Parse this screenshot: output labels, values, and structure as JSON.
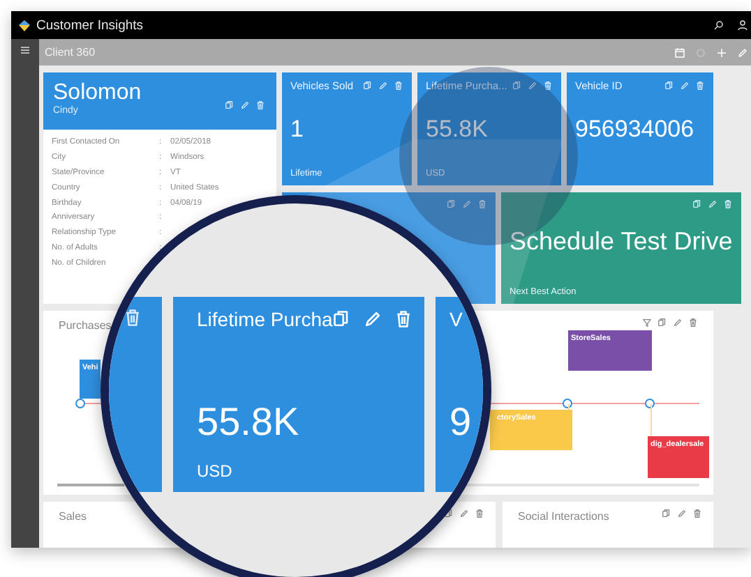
{
  "window": {
    "title": "Customer Insights"
  },
  "page": {
    "title": "Client 360"
  },
  "contact_card": {
    "name": "Solomon",
    "subtitle": "Cindy",
    "fields": [
      {
        "label": "First Contacted On",
        "separator": ":",
        "value": "02/05/2018"
      },
      {
        "label": "City",
        "separator": ":",
        "value": "Windsors"
      },
      {
        "label": "State/Province",
        "separator": ":",
        "value": "VT"
      },
      {
        "label": "Country",
        "separator": ":",
        "value": "United States"
      },
      {
        "label": "Birthday",
        "separator": ":",
        "value": "04/08/19"
      },
      {
        "label": "Anniversary",
        "separator": ":"
      },
      {
        "label": "Relationship Type",
        "separator": ":"
      },
      {
        "label": "No. of Adults",
        "separator": ":"
      },
      {
        "label": "No. of Children"
      }
    ]
  },
  "tiles": [
    {
      "title": "Vehicles Sold",
      "value": "1",
      "caption": "Lifetime",
      "color": "#2f8fdf"
    },
    {
      "title": "Lifetime Purcha...",
      "value": "55.8K",
      "caption": "USD",
      "color": "#2f8fdf"
    },
    {
      "title": "Vehicle ID",
      "value": "956934006",
      "color": "#2f8fdf"
    }
  ],
  "action_tiles": [
    {
      "kind": "blank",
      "color": "#2f8fdf"
    },
    {
      "kind": "action",
      "value": "Schedule Test Drive",
      "caption": "Next Best Action",
      "color": "#2e9b86"
    }
  ],
  "purchases": {
    "title": "Purchases",
    "events": [
      {
        "title": "Vehi",
        "color": "#2f8fdf"
      },
      {
        "title": "StoreSales",
        "color": "#7a4fa8"
      },
      {
        "title": "ctorySales",
        "color": "#fbc94a"
      },
      {
        "title": "dig_dealersale",
        "color": "#e83a47"
      }
    ]
  },
  "panels": [
    {
      "title": "Sales"
    },
    {
      "title": "Social Interactions"
    }
  ],
  "magnifier": {
    "tiles": [
      {
        "kind": "edge"
      },
      {
        "kind": "full",
        "title": "Lifetime Purcha",
        "value": "55.8K",
        "caption": "USD"
      },
      {
        "kind": "partial",
        "title": "V",
        "value": "9"
      }
    ]
  }
}
